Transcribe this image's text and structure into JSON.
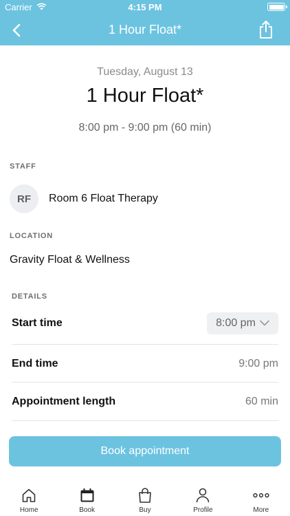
{
  "status_bar": {
    "carrier": "Carrier",
    "time": "4:15 PM"
  },
  "nav": {
    "title": "1 Hour Float*",
    "back_icon": "chevron-left-icon",
    "share_icon": "share-icon"
  },
  "appointment": {
    "date": "Tuesday, August 13",
    "name": "1 Hour Float*",
    "time_range": "8:00 pm - 9:00 pm (60 min)"
  },
  "staff": {
    "section_label": "STAFF",
    "initials": "RF",
    "name": "Room 6 Float Therapy"
  },
  "location": {
    "section_label": "LOCATION",
    "name": "Gravity Float & Wellness"
  },
  "details": {
    "section_label": "DETAILS",
    "start_time_label": "Start time",
    "start_time_value": "8:00 pm",
    "end_time_label": "End time",
    "end_time_value": "9:00 pm",
    "length_label": "Appointment length",
    "length_value": "60 min"
  },
  "book_button_label": "Book appointment",
  "tabs": [
    {
      "label": "Home",
      "icon": "home-icon"
    },
    {
      "label": "Book",
      "icon": "calendar-icon",
      "active": true
    },
    {
      "label": "Buy",
      "icon": "shopping-bag-icon"
    },
    {
      "label": "Profile",
      "icon": "person-icon"
    },
    {
      "label": "More",
      "icon": "more-dots-icon"
    }
  ],
  "colors": {
    "brand": "#6cc3e0",
    "avatar_bg": "#eceef1",
    "muted_text": "#777777"
  }
}
